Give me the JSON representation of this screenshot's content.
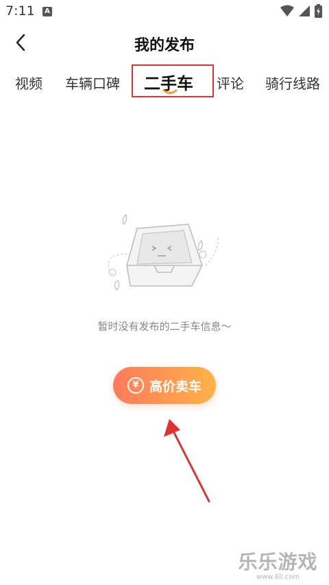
{
  "status_bar": {
    "time": "7:11",
    "app_badge": "A"
  },
  "header": {
    "title": "我的发布"
  },
  "tabs": [
    {
      "label": "视频",
      "active": false
    },
    {
      "label": "车辆口碑",
      "active": false
    },
    {
      "label": "二手车",
      "active": true
    },
    {
      "label": "评论",
      "active": false
    },
    {
      "label": "骑行线路",
      "active": false
    }
  ],
  "empty_state": {
    "message": "暂时没有发布的二手车信息～"
  },
  "sell_button": {
    "icon_symbol": "¥",
    "label": "高价卖车"
  },
  "watermark": {
    "text": "乐乐游戏",
    "url": "www.6ll.com"
  },
  "colors": {
    "button_gradient_start": "#ff7a5c",
    "button_gradient_end": "#ffb347",
    "tab_indicator": "#ff9a2e",
    "annotation_red": "#e03030"
  }
}
